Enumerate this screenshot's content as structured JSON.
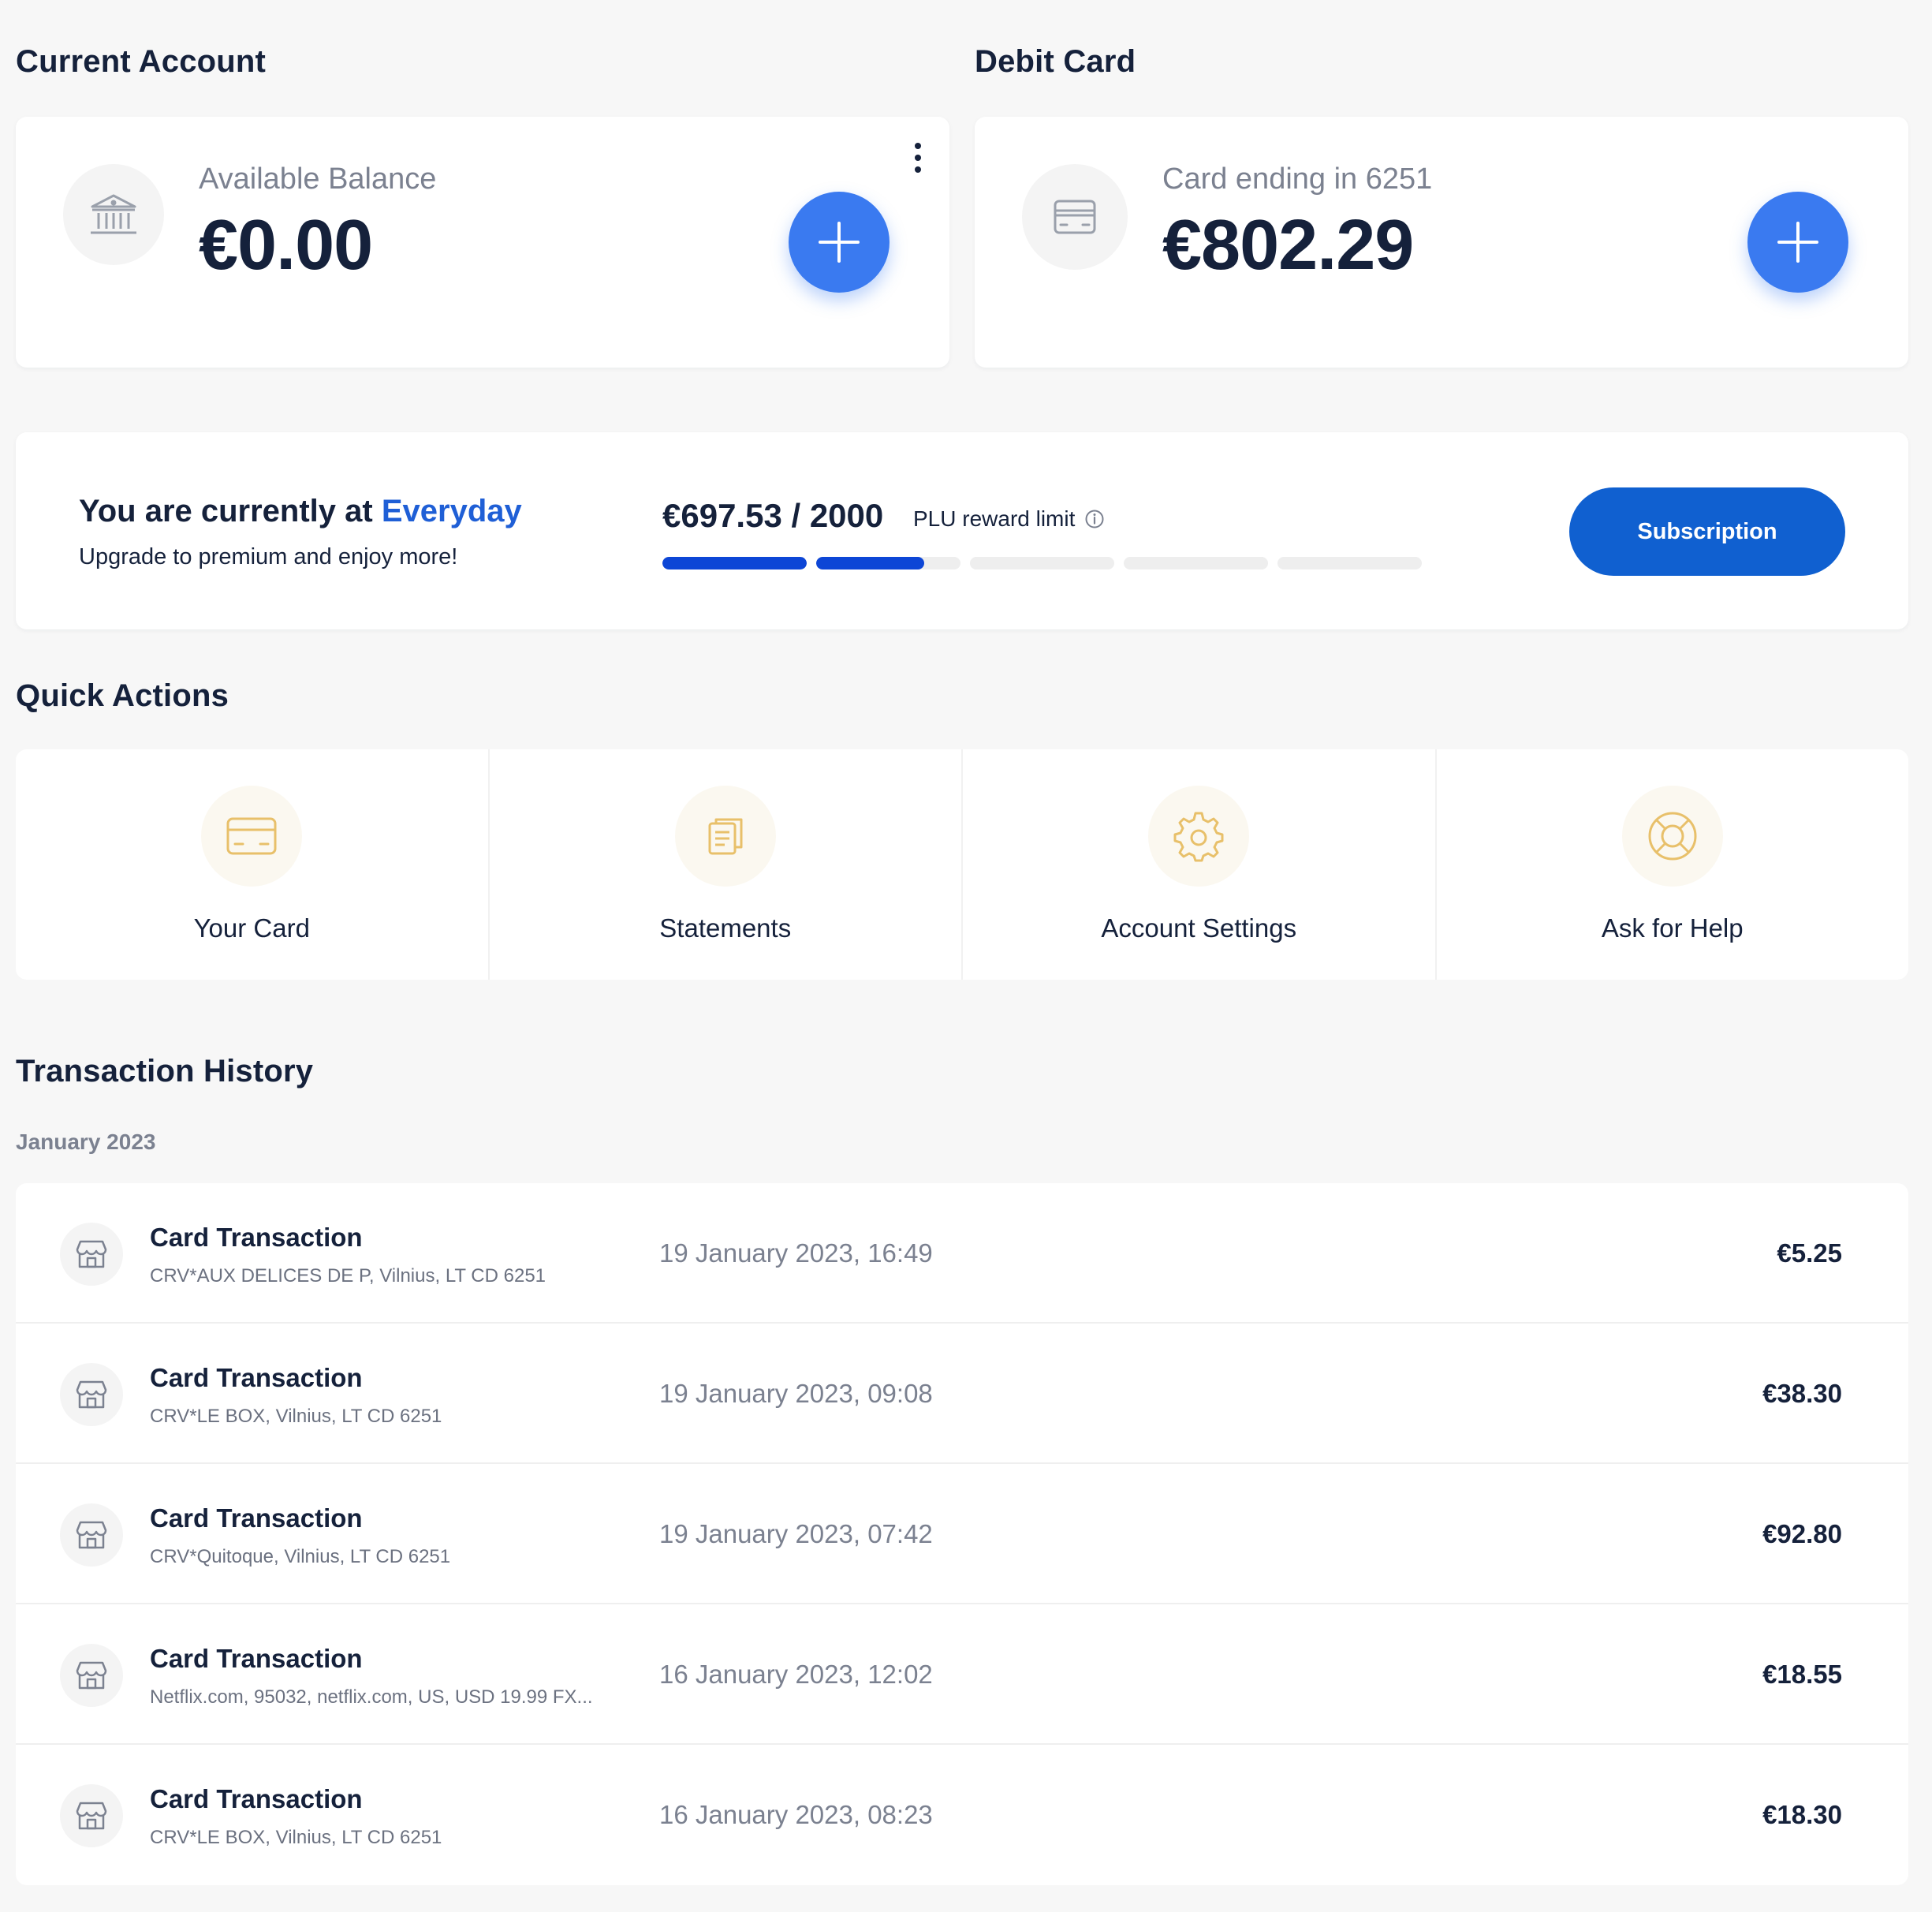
{
  "current_account": {
    "section_title": "Current Account",
    "balance_label": "Available Balance",
    "balance_value": "€0.00"
  },
  "debit_card": {
    "section_title": "Debit Card",
    "card_label": "Card ending in 6251",
    "balance_value": "€802.29"
  },
  "plan": {
    "title_prefix": "You are currently at",
    "plan_name": "Everyday",
    "subtitle": "Upgrade to premium and enjoy more!",
    "reward_amount": "€697.53 / 2000",
    "reward_label": "PLU reward limit",
    "reward_progress_fraction": 0.35,
    "subscription_button": "Subscription"
  },
  "quick_actions": {
    "section_title": "Quick Actions",
    "items": [
      {
        "label": "Your Card",
        "icon": "credit-card-icon"
      },
      {
        "label": "Statements",
        "icon": "document-icon"
      },
      {
        "label": "Account Settings",
        "icon": "gear-icon"
      },
      {
        "label": "Ask for Help",
        "icon": "lifebuoy-icon"
      }
    ]
  },
  "transactions": {
    "section_title": "Transaction History",
    "month": "January 2023",
    "items": [
      {
        "title": "Card Transaction",
        "description": "CRV*AUX DELICES DE P, Vilnius, LT CD 6251",
        "date": "19 January 2023, 16:49",
        "amount": "€5.25"
      },
      {
        "title": "Card Transaction",
        "description": "CRV*LE BOX, Vilnius, LT CD 6251",
        "date": "19 January 2023, 09:08",
        "amount": "€38.30"
      },
      {
        "title": "Card Transaction",
        "description": "CRV*Quitoque, Vilnius, LT CD 6251",
        "date": "19 January 2023, 07:42",
        "amount": "€92.80"
      },
      {
        "title": "Card Transaction",
        "description": "Netflix.com, 95032, netflix.com, US, USD 19.99 FX...",
        "date": "16 January 2023, 12:02",
        "amount": "€18.55"
      },
      {
        "title": "Card Transaction",
        "description": "CRV*LE BOX, Vilnius, LT CD 6251",
        "date": "16 January 2023, 08:23",
        "amount": "€18.30"
      }
    ]
  },
  "colors": {
    "accent_blue": "#3a7af0",
    "button_blue": "#1060d0",
    "progress_blue": "#0d46d6",
    "text_dark": "#15213b",
    "text_muted": "#7b8190",
    "icon_gold": "#e8c06a"
  }
}
